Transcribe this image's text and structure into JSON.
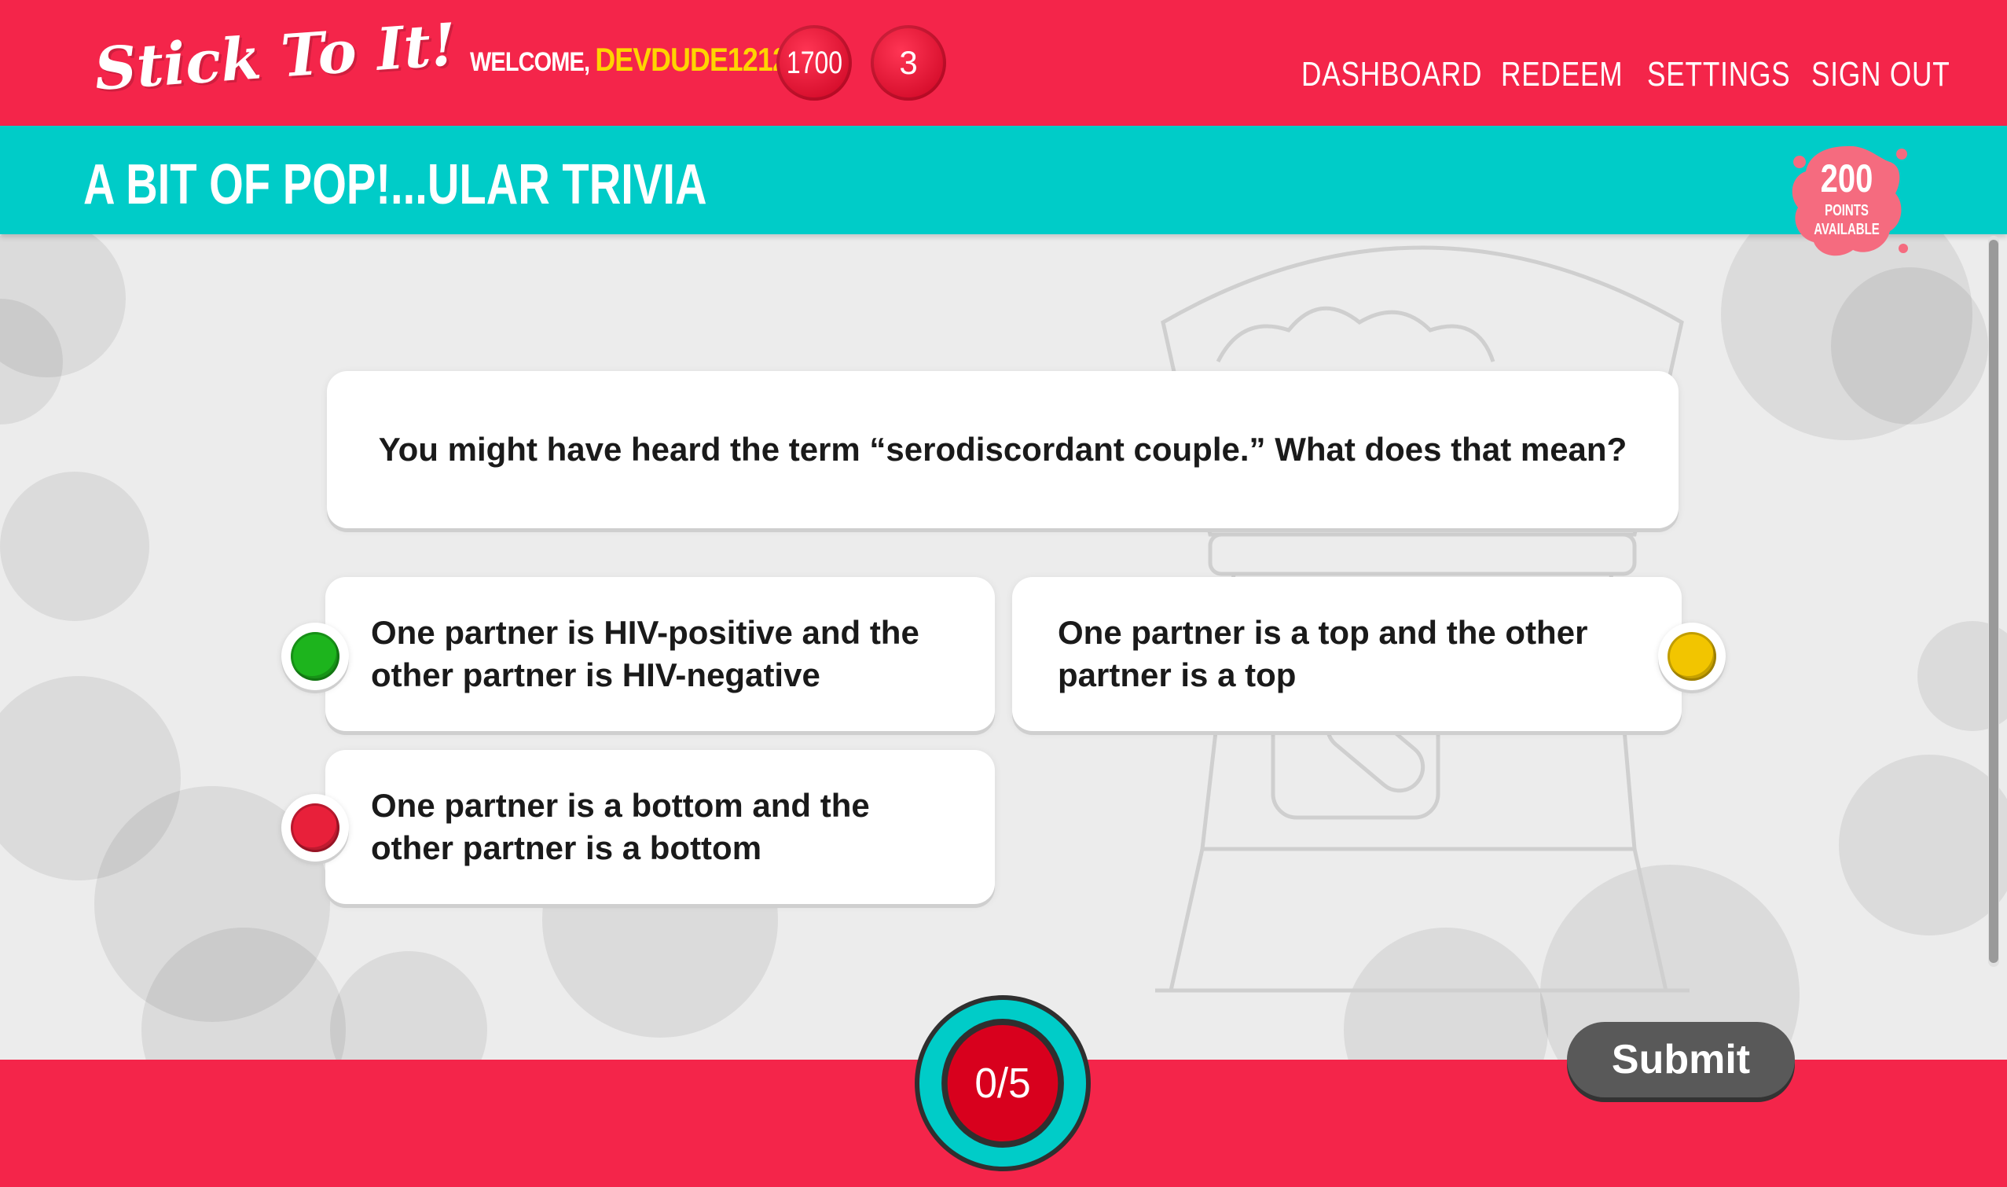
{
  "header": {
    "logo": "Stick To It!",
    "welcome_prefix": "WELCOME, ",
    "username": "DEVDUDE1212",
    "welcome_suffix": "!",
    "points": "1700",
    "count": "3",
    "nav": [
      "DASHBOARD",
      "REDEEM",
      "SETTINGS",
      "SIGN OUT"
    ]
  },
  "quiz": {
    "title": "A BIT OF POP!...ULAR TRIVIA",
    "points_available": "200",
    "points_label_line1": "POINTS",
    "points_label_line2": "AVAILABLE",
    "question": "You might have heard the term “serodiscordant couple.” What does that mean?",
    "answers": [
      {
        "text": "One partner is HIV-positive and the other partner is HIV-negative",
        "color": "#1db41d"
      },
      {
        "text": "One partner is a top and the other partner is a top",
        "color": "#f2c500"
      },
      {
        "text": "One partner is a bottom and the other partner is a bottom",
        "color": "#e8203a"
      }
    ],
    "progress": "0/5",
    "submit_label": "Submit"
  },
  "colors": {
    "brand_red": "#f4254a",
    "teal": "#00ccc8",
    "username_yellow": "#ffd400",
    "submit_gray": "#595959"
  },
  "icons": [
    "points-coin-icon",
    "counter-bubble-icon",
    "points-splat-icon"
  ]
}
